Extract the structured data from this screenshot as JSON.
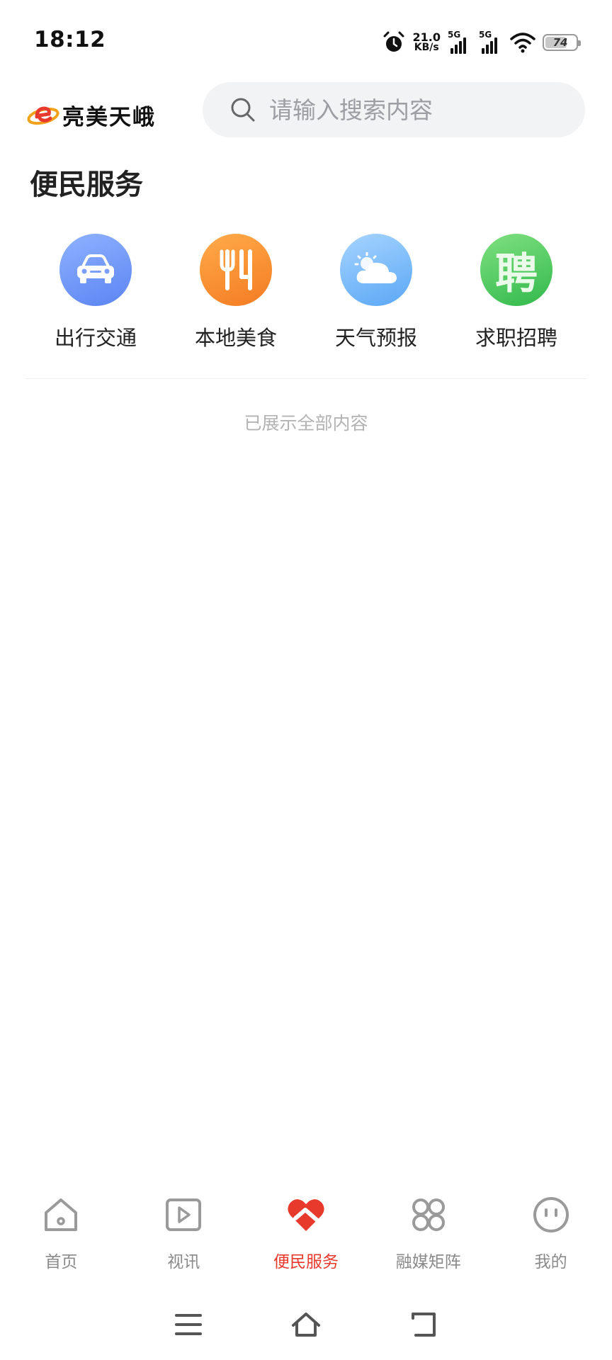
{
  "status_bar": {
    "time": "18:12",
    "net_speed_value": "21.0",
    "net_speed_unit": "KB/s",
    "sim1_type": "5G",
    "sim2_type": "5G",
    "battery_percent": "74",
    "battery_level": 0.74,
    "icons": [
      "alarm-icon",
      "wifi-icon",
      "battery-icon"
    ]
  },
  "header": {
    "app_name": "亮美天峨",
    "search_placeholder": "请输入搜索内容"
  },
  "section": {
    "title": "便民服务"
  },
  "services": [
    {
      "label": "出行交通",
      "icon": "car-icon"
    },
    {
      "label": "本地美食",
      "icon": "fork-knife-icon"
    },
    {
      "label": "天气预报",
      "icon": "sun-cloud-icon"
    },
    {
      "label": "求职招聘",
      "icon": "recruit-icon",
      "glyph": "聘"
    }
  ],
  "end_note": "已展示全部内容",
  "tabs": [
    {
      "label": "首页",
      "icon": "home-icon",
      "active": false
    },
    {
      "label": "视讯",
      "icon": "play-icon",
      "active": false
    },
    {
      "label": "便民服务",
      "icon": "heart-icon",
      "active": true
    },
    {
      "label": "融媒矩阵",
      "icon": "grid-icon",
      "active": false
    },
    {
      "label": "我的",
      "icon": "face-icon",
      "active": false
    }
  ],
  "colors": {
    "accent": "#e8392d",
    "inactive": "#8a8a8a",
    "search_bg": "#f2f3f5"
  },
  "system_nav": [
    "menu-icon",
    "home-outline-icon",
    "back-icon"
  ]
}
